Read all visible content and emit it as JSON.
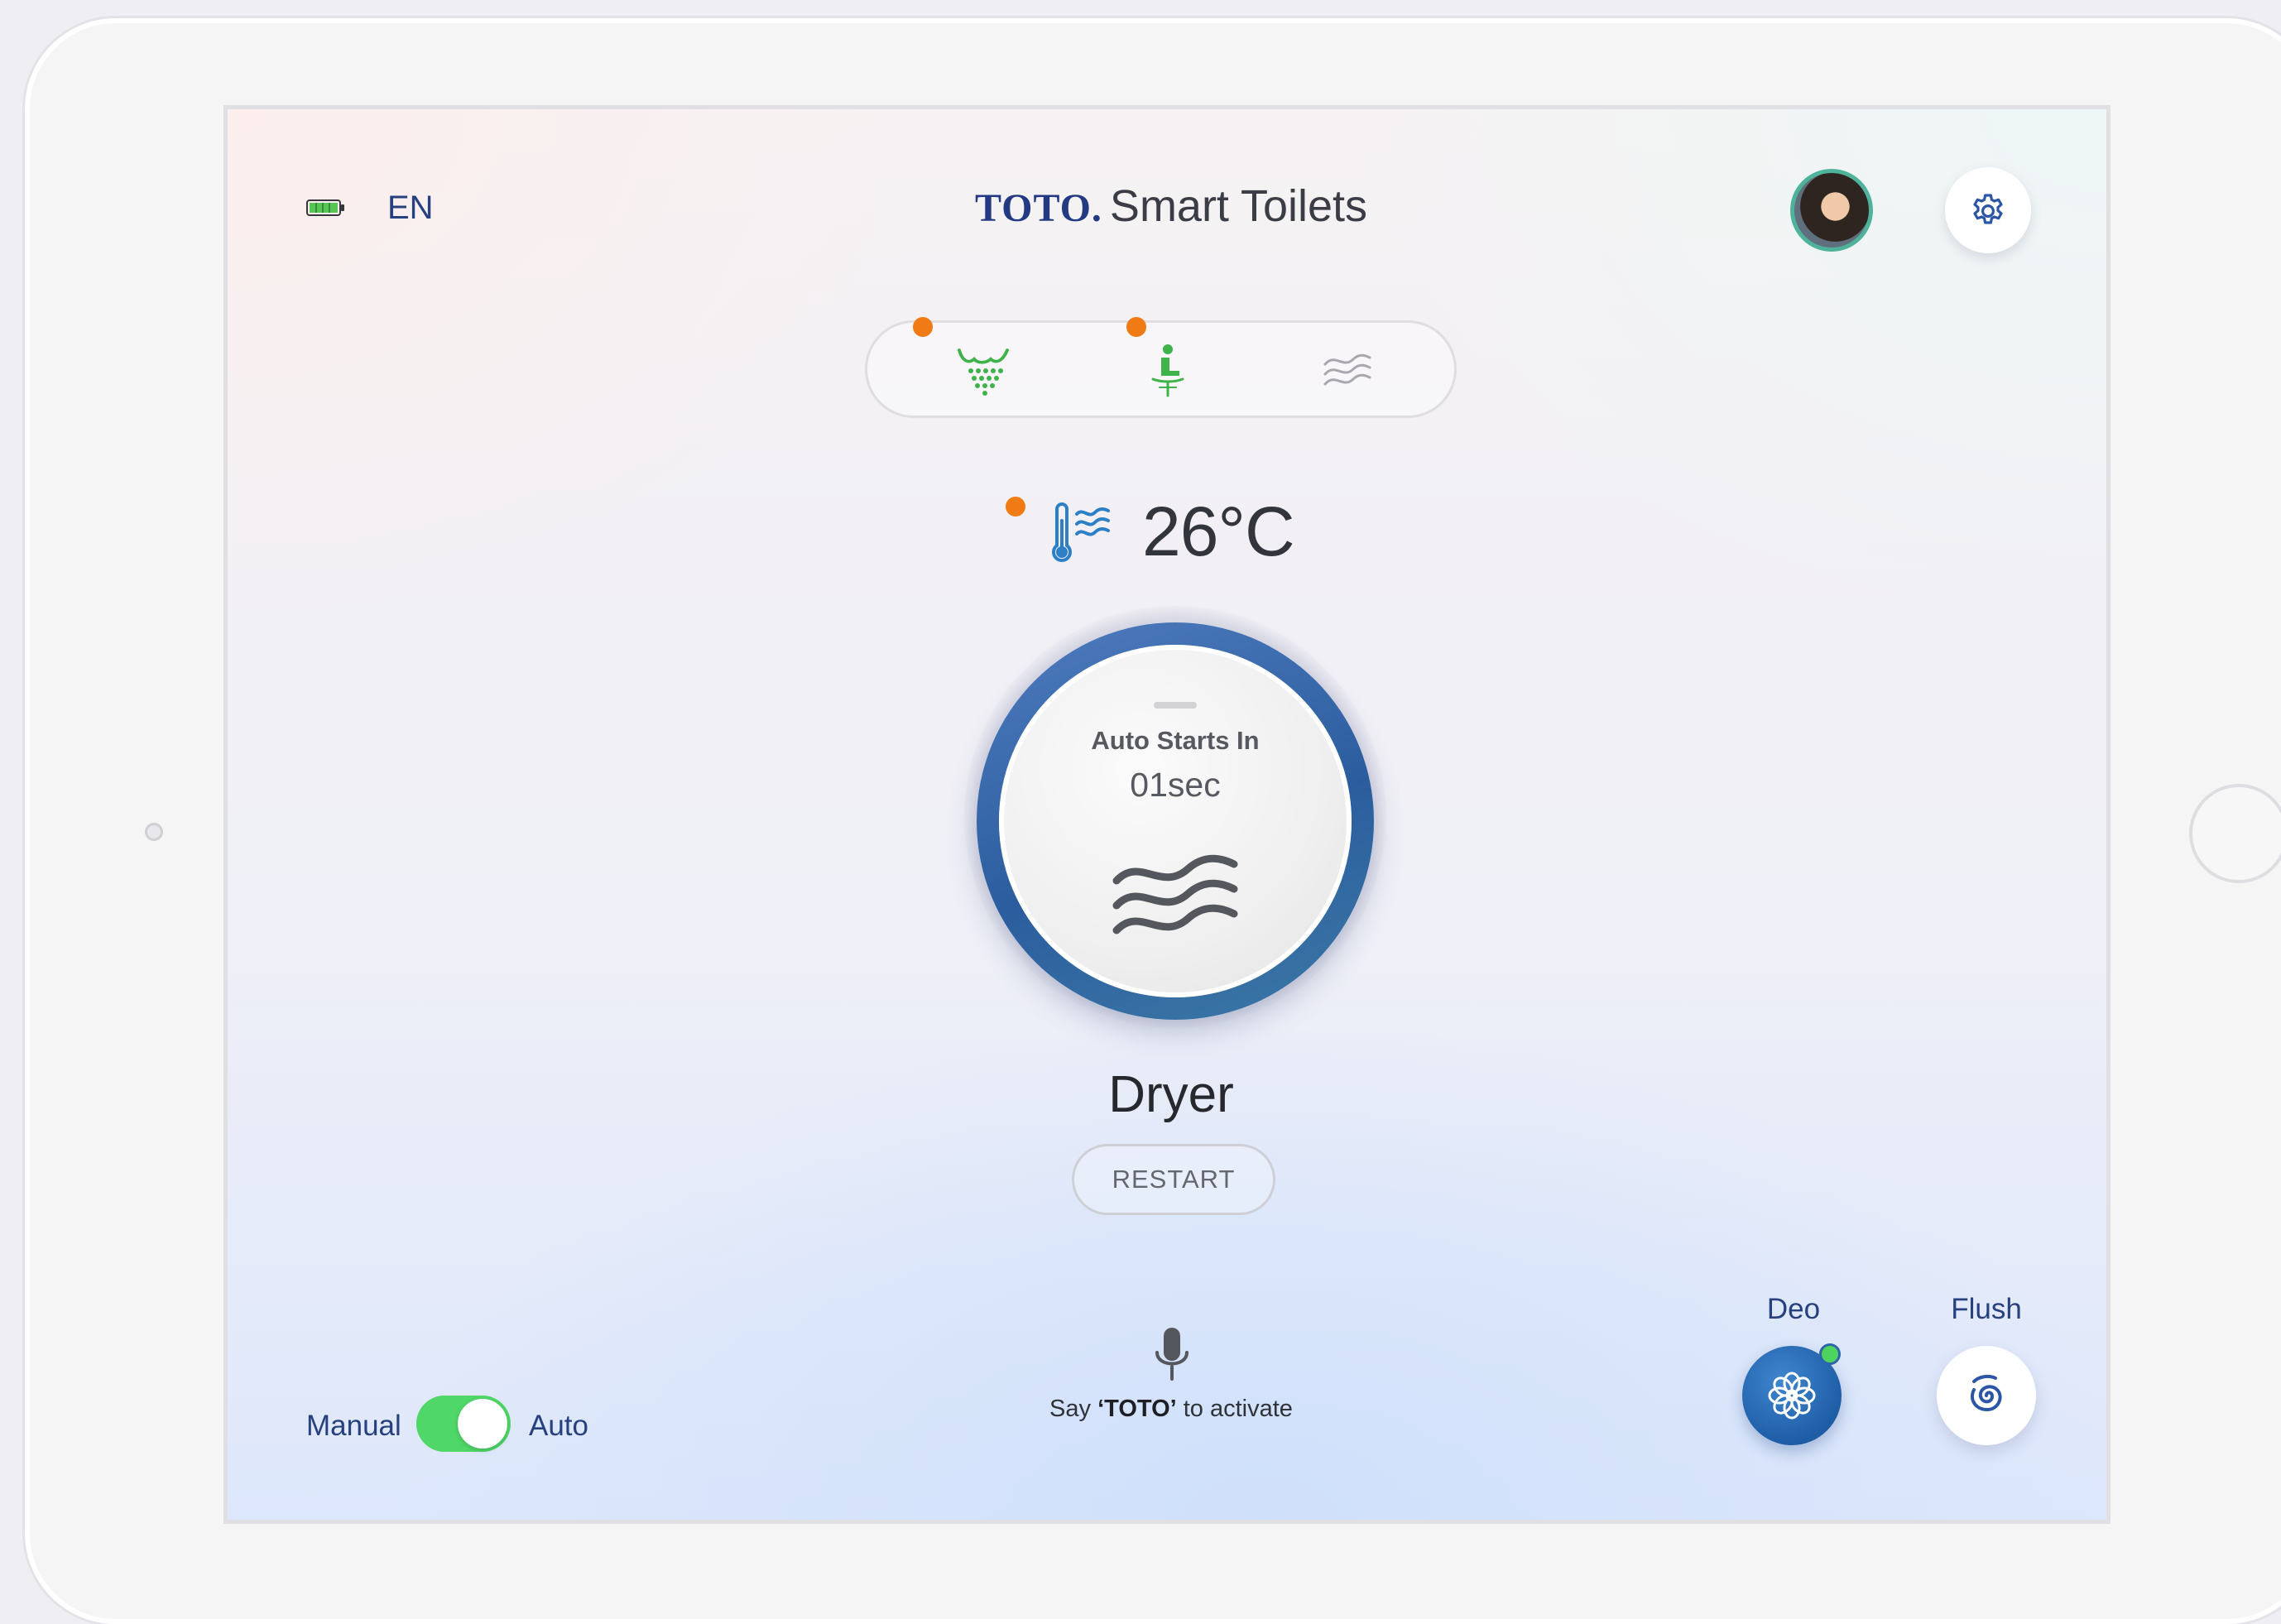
{
  "status": {
    "language": "EN",
    "battery_icon": "battery-icon"
  },
  "header": {
    "brand_logo": "TOTO",
    "brand_mark": ".",
    "brand_name": "Smart Toilets",
    "avatar_icon": "user-avatar",
    "settings_icon": "gear-icon"
  },
  "modes": [
    {
      "icon": "bidet-spray-icon",
      "active": true,
      "color": "#3fb24a"
    },
    {
      "icon": "seat-user-icon",
      "active": true,
      "color": "#3fb24a"
    },
    {
      "icon": "dryer-wave-icon",
      "active": false,
      "color": "#a8a8ae"
    }
  ],
  "temperature": {
    "icon": "thermometer-air-icon",
    "value": "26°C"
  },
  "dial": {
    "label": "Auto Starts In",
    "countdown": "01sec",
    "icon": "dryer-wave-icon"
  },
  "current_mode": "Dryer",
  "restart_label": "RESTART",
  "toggle": {
    "left_label": "Manual",
    "right_label": "Auto",
    "state": "Auto",
    "on_color": "#4fd768"
  },
  "voice": {
    "icon": "microphone-icon",
    "prefix": "Say ",
    "keyword": "‘TOTO’",
    "suffix": " to activate"
  },
  "actions": {
    "deo_label": "Deo",
    "flush_label": "Flush"
  },
  "colors": {
    "indicator_dot": "#f07a14",
    "brand": "#233a82",
    "accent_blue": "#2b5d9e",
    "deo_active": "#4fd35f"
  }
}
